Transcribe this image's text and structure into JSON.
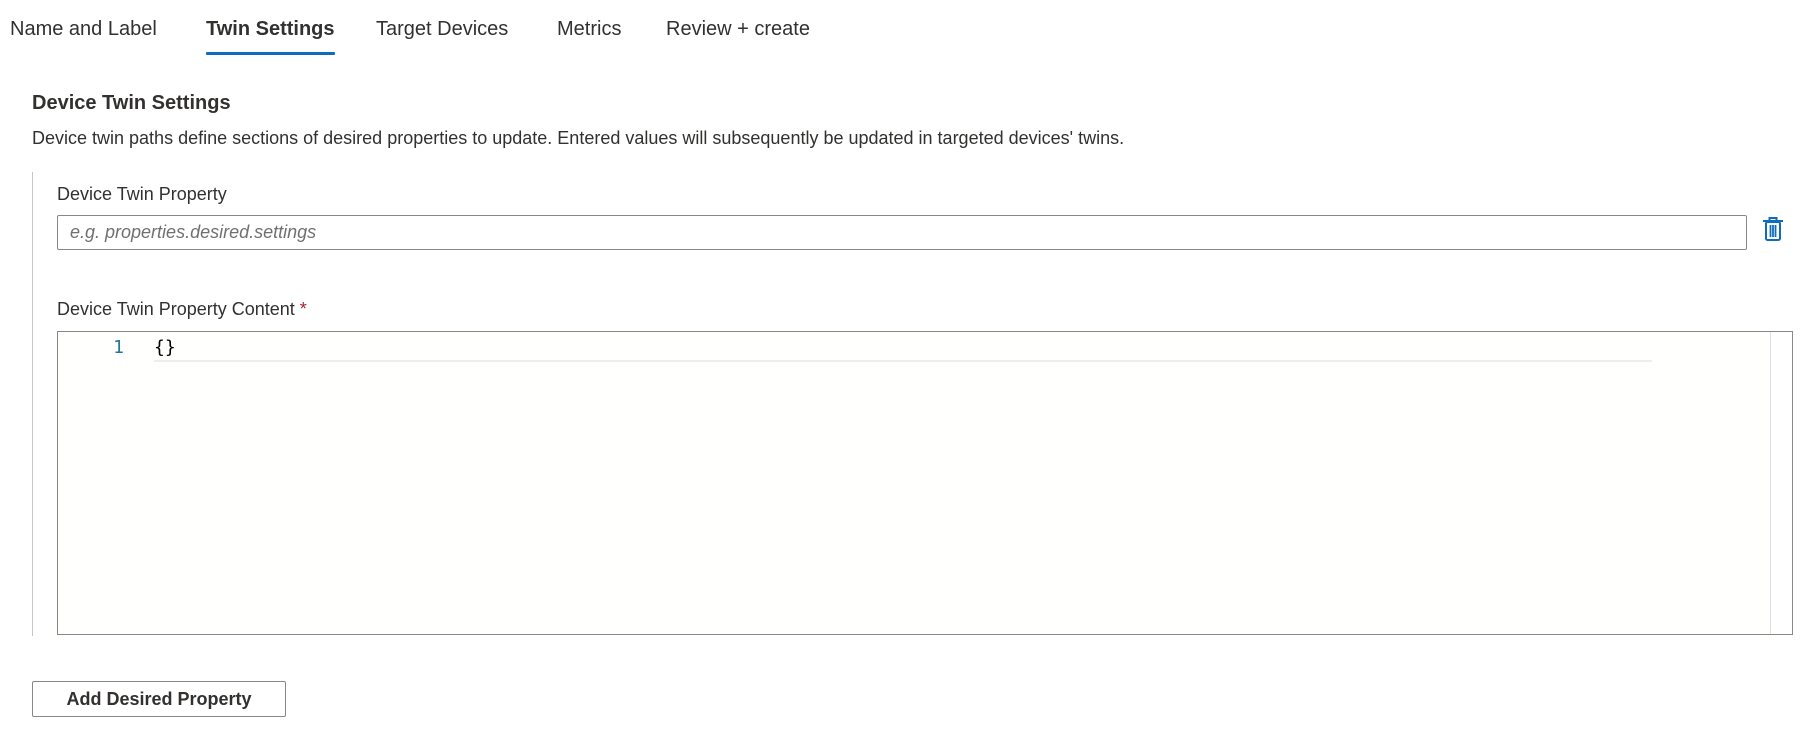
{
  "tabs": [
    {
      "label": "Name and Label",
      "active": false
    },
    {
      "label": "Twin Settings",
      "active": true
    },
    {
      "label": "Target Devices",
      "active": false
    },
    {
      "label": "Metrics",
      "active": false
    },
    {
      "label": "Review + create",
      "active": false
    }
  ],
  "section": {
    "title": "Device Twin Settings",
    "description": "Device twin paths define sections of desired properties to update. Entered values will subsequently be updated in targeted devices' twins."
  },
  "property": {
    "label": "Device Twin Property",
    "value": "",
    "placeholder": "e.g. properties.desired.settings",
    "delete_icon": "trash-icon"
  },
  "content": {
    "label": "Device Twin Property Content",
    "required_marker": "*",
    "lines": [
      {
        "number": "1",
        "text": "{}"
      }
    ]
  },
  "actions": {
    "add_label": "Add Desired Property"
  },
  "colors": {
    "accent": "#0f6cbd",
    "required": "#a4262c",
    "line_number": "#237893"
  }
}
